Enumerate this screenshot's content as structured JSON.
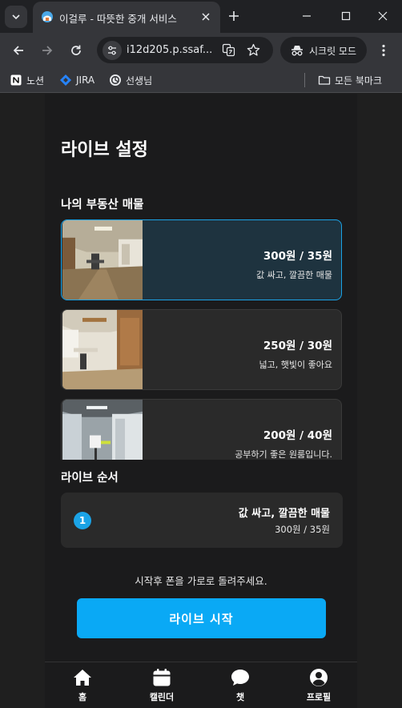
{
  "browser": {
    "tab_title": "이걸루 - 따뜻한 중개 서비스",
    "url": "i12d205.p.ssaf...",
    "incognito_label": "시크릿 모드",
    "bookmarks": [
      {
        "label": "노션",
        "icon": "notion-icon"
      },
      {
        "label": "JIRA",
        "icon": "jira-icon"
      },
      {
        "label": "선생님",
        "icon": "openai-icon"
      }
    ],
    "all_bookmarks_label": "모든 북마크"
  },
  "page": {
    "title": "라이브 설정",
    "my_listings_title": "나의 부동산 매물",
    "listings": [
      {
        "price": "300원 / 35원",
        "description": "값 싸고, 깔끔한 매물",
        "selected": true
      },
      {
        "price": "250원 / 30원",
        "description": "넓고, 햇빛이 좋아요",
        "selected": false
      },
      {
        "price": "200원 / 40원",
        "description": "공부하기 좋은 원룸입니다.",
        "selected": false
      }
    ],
    "order_title": "라이브 순서",
    "order": [
      {
        "number": "1",
        "description": "값 싸고, 깔끔한 매물",
        "price": "300원 / 35원"
      }
    ],
    "hint": "시작후 폰을 가로로 돌려주세요.",
    "start_button": "라이브 시작"
  },
  "bottom_nav": [
    {
      "label": "홈",
      "icon": "home-icon"
    },
    {
      "label": "캘린더",
      "icon": "calendar-icon"
    },
    {
      "label": "챗",
      "icon": "chat-icon"
    },
    {
      "label": "프로필",
      "icon": "profile-icon"
    }
  ],
  "colors": {
    "accent": "#0aa9f5",
    "selected_bg": "#1e333f",
    "card_bg": "#2a2a2a",
    "app_bg": "#1b1b1c"
  }
}
